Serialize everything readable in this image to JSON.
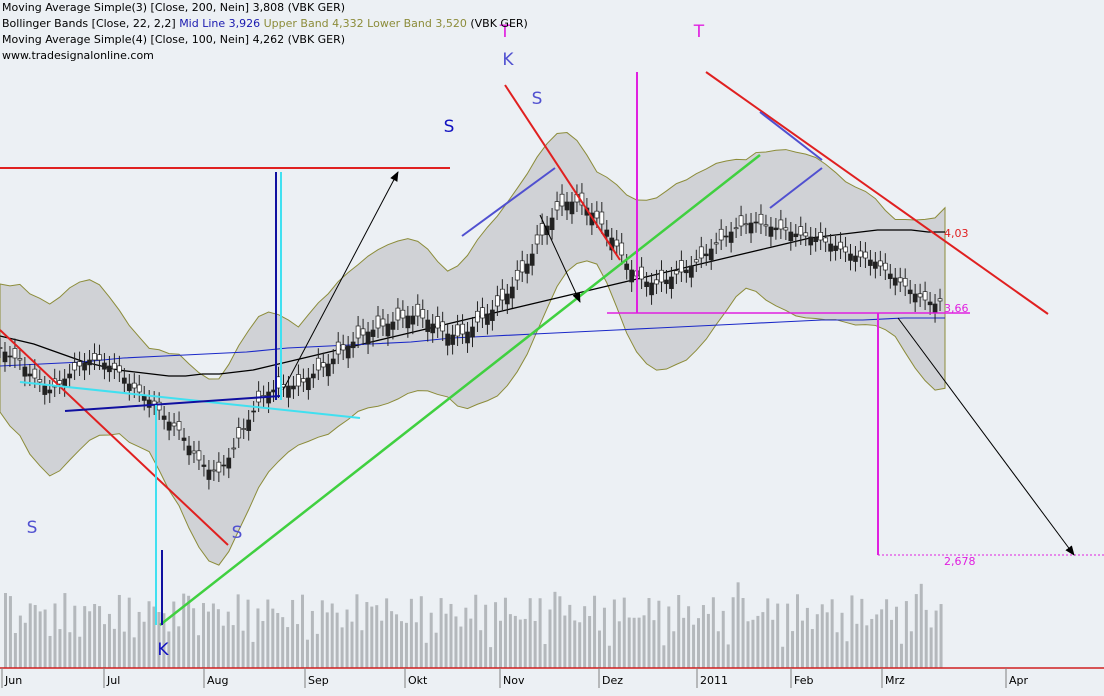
{
  "legend": {
    "ma200": {
      "text": "Moving Average Simple(3) [Close, 200, Nein] 3,808 (VBK GER)"
    },
    "bb": {
      "prefix": "Bollinger Bands [Close, 22, 2,2]",
      "mid": "Mid Line 3,926",
      "upper": "Upper Band 4,332",
      "lower": "Lower Band 3,520",
      "suffix": "(VBK GER)"
    },
    "ma100": {
      "text": "Moving Average Simple(4) [Close, 100, Nein] 4,262 (VBK GER)"
    },
    "website": "www.tradesignalonline.com"
  },
  "colors": {
    "background": "#ecf0f4",
    "band_fill": "#d0d2d6",
    "band_line": "#8c8c3a",
    "ma200": "#000000",
    "ma100": "#1a28c8",
    "red_line": "#e02020",
    "green_line": "#40d040",
    "magenta": "#e020e0",
    "cyan": "#40e0f0",
    "navy": "#1010a0",
    "volume": "#b4b8bc"
  },
  "chart_data": {
    "type": "candlestick",
    "xlabels": [
      "Jun",
      "Jul",
      "Aug",
      "Sep",
      "Okt",
      "Nov",
      "Dez",
      "2011",
      "Feb",
      "Mrz",
      "Apr"
    ],
    "price_labels": {
      "upper": "4,03",
      "middle": "3,66",
      "lower": "2,678"
    },
    "pattern_labels": [
      {
        "label": "S"
      },
      {
        "label": "S"
      },
      {
        "label": "K"
      },
      {
        "label": "S"
      },
      {
        "label": "K"
      },
      {
        "label": "S"
      },
      {
        "label": "T"
      },
      {
        "label": "T"
      }
    ],
    "close": [
      3.66,
      3.62,
      3.6,
      3.53,
      3.49,
      3.45,
      3.48,
      3.53,
      3.57,
      3.6,
      3.6,
      3.57,
      3.54,
      3.48,
      3.44,
      3.4,
      3.35,
      3.29,
      3.25,
      3.17,
      3.1,
      3.05,
      3.04,
      3.11,
      3.21,
      3.3,
      3.39,
      3.44,
      3.46,
      3.47,
      3.47,
      3.51,
      3.55,
      3.58,
      3.63,
      3.67,
      3.71,
      3.74,
      3.76,
      3.78,
      3.8,
      3.82,
      3.82,
      3.8,
      3.76,
      3.73,
      3.72,
      3.74,
      3.79,
      3.83,
      3.87,
      3.93,
      4.0,
      4.08,
      4.18,
      4.27,
      4.35,
      4.39,
      4.39,
      4.36,
      4.31,
      4.25,
      4.17,
      4.08,
      4.02,
      3.99,
      3.98,
      4.0,
      4.03,
      4.05,
      4.09,
      4.13,
      4.18,
      4.22,
      4.26,
      4.28,
      4.29,
      4.27,
      4.26,
      4.25,
      4.23,
      4.22,
      4.21,
      4.19,
      4.17,
      4.14,
      4.12,
      4.11,
      4.09,
      4.05,
      4.01,
      3.97,
      3.93,
      3.9,
      3.88,
      3.91
    ],
    "ma200": [
      3.72,
      3.7,
      3.68,
      3.65,
      3.62,
      3.59,
      3.57,
      3.55,
      3.54,
      3.53,
      3.52,
      3.52,
      3.53,
      3.53,
      3.54,
      3.55,
      3.57,
      3.59,
      3.61,
      3.63,
      3.65,
      3.67,
      3.69,
      3.71,
      3.73,
      3.75,
      3.77,
      3.79,
      3.81,
      3.83,
      3.85,
      3.87,
      3.89,
      3.91,
      3.93,
      3.95,
      3.97,
      3.99,
      4.01,
      4.03,
      4.05,
      4.07,
      4.09,
      4.11,
      4.13,
      4.15,
      4.17,
      4.19,
      4.21,
      4.22,
      4.23,
      4.24,
      4.25,
      4.25,
      4.25,
      4.24,
      4.24
    ],
    "ma100": [
      3.57,
      3.58,
      3.59,
      3.61,
      3.62,
      3.63,
      3.64,
      3.66,
      3.67,
      3.68,
      3.69,
      3.71,
      3.72,
      3.73,
      3.74,
      3.75,
      3.76,
      3.77,
      3.78,
      3.79,
      3.8,
      3.8,
      3.81,
      3.81
    ],
    "ylim": [
      2.4,
      4.6
    ],
    "volume_note": "relative volume bars"
  }
}
